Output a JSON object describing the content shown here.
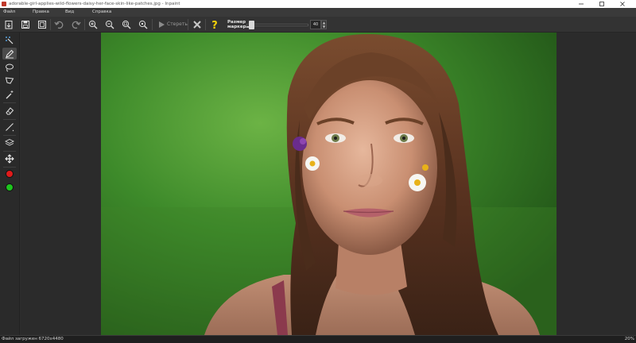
{
  "window": {
    "title": "adorable-girl-applies-wild-flowers-daisy-her-face-skin-like-patches.jpg - Inpaint"
  },
  "menu": {
    "items": [
      "Файл",
      "Правка",
      "Вид",
      "Справка"
    ]
  },
  "toolbar": {
    "open_icon": "open-file-icon",
    "save_icon": "save-icon",
    "save_as_icon": "save-as-icon",
    "undo_icon": "undo-icon",
    "redo_icon": "redo-icon",
    "zoom_in_icon": "zoom-in-icon",
    "zoom_out_icon": "zoom-out-icon",
    "zoom_fit_icon": "zoom-fit-icon",
    "zoom_actual_icon": "zoom-actual-icon",
    "erase_label": "Стереть",
    "cancel_icon": "cancel-icon",
    "help_icon": "help-icon",
    "marker_size_label_line1": "Размер",
    "marker_size_label_line2": "маркера",
    "marker_size_value": "40",
    "marker_size_level": 0.05
  },
  "tools": [
    {
      "name": "smart-select-tool",
      "icon": "magic-cursor-icon",
      "active": false
    },
    {
      "name": "marker-tool",
      "icon": "marker-icon",
      "active": true
    },
    {
      "name": "lasso-tool",
      "icon": "lasso-icon",
      "active": false
    },
    {
      "name": "polygon-lasso-tool",
      "icon": "polygon-lasso-icon",
      "active": false
    },
    {
      "name": "magic-wand-tool",
      "icon": "magic-wand-icon",
      "active": false
    },
    {
      "name": "eraser-tool",
      "icon": "eraser-icon",
      "active": false
    },
    {
      "name": "line-tool",
      "icon": "line-icon",
      "active": false
    },
    {
      "name": "layers-tool",
      "icon": "layers-icon",
      "active": false
    },
    {
      "name": "move-tool",
      "icon": "move-icon",
      "active": false
    }
  ],
  "colors": {
    "mask_color": "#e01b1b",
    "donor_color": "#1ec41e",
    "accent_yellow": "#f2d10a"
  },
  "status": {
    "text": "Файл загружен 6720x4480",
    "zoom": "20%"
  }
}
